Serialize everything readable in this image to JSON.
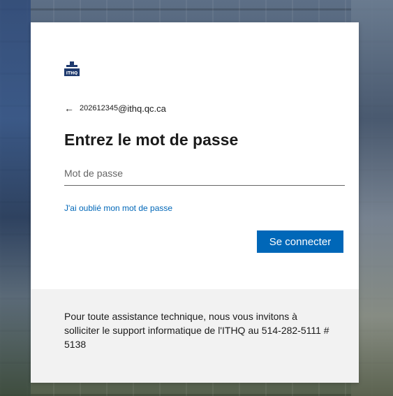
{
  "login": {
    "identity_number": "202612345",
    "identity_domain": "@ithq.qc.ca",
    "title": "Entrez le mot de passe",
    "password_placeholder": "Mot de passe",
    "forgot_link": "J'ai oublié mon mot de passe",
    "signin_button": "Se connecter"
  },
  "logo": {
    "text": "ITHQ"
  },
  "footer": {
    "text": "Pour toute assistance technique, nous vous invitons à solliciter le support informatique de l'ITHQ au 514-282-5111 # 5138"
  },
  "colors": {
    "accent": "#0067b8",
    "card_bg": "#ffffff",
    "footer_bg": "#f2f2f2",
    "text": "#1b1b1b",
    "logo_blue": "#1f3a6e"
  },
  "icons": {
    "back": "back-arrow-icon",
    "logo": "ithq-logo-icon"
  }
}
